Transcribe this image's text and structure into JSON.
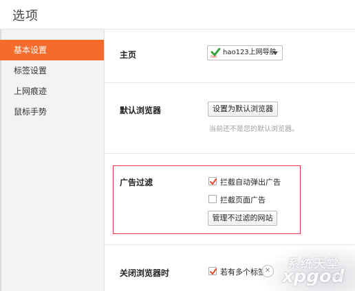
{
  "window": {
    "title": "选项"
  },
  "sidebar": {
    "items": [
      {
        "label": "基本设置",
        "active": true
      },
      {
        "label": "标签设置",
        "active": false
      },
      {
        "label": "上网痕迹",
        "active": false
      },
      {
        "label": "鼠标手势",
        "active": false
      }
    ]
  },
  "homepage": {
    "label": "主页",
    "selected": "hao123上网导航",
    "icon": "hao123-logo-icon",
    "logo_text": "hao"
  },
  "default_browser": {
    "label": "默认浏览器",
    "button": "设置为默认浏览器",
    "hint": "当前还不是您的默认浏览器。"
  },
  "ad_filter": {
    "label": "广告过滤",
    "popup_block": {
      "label": "拦截自动弹出广告",
      "checked": true
    },
    "page_block": {
      "label": "拦截页面广告",
      "checked": false
    },
    "manage_button": "管理不过滤的网站"
  },
  "close_browser": {
    "label": "关闭浏览器时",
    "option": {
      "label": "若有多个标签",
      "checked": true
    }
  },
  "watermark": {
    "line1": "系统天堂",
    "line2": "xpgod",
    "line3": ".com"
  },
  "colors": {
    "accent": "#f46b2b",
    "highlight_border": "#e0363a"
  }
}
